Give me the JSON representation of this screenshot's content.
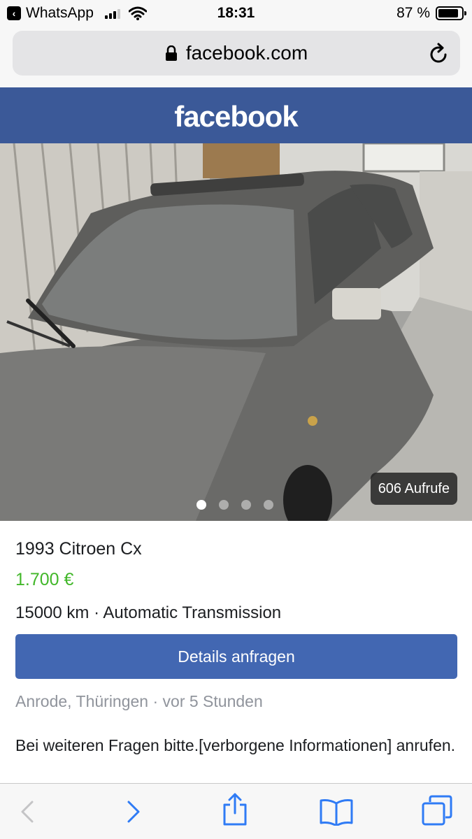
{
  "status_bar": {
    "back_app": "WhatsApp",
    "time": "18:31",
    "battery": "87 %",
    "battery_level": 0.87,
    "icons": [
      "back-arrow-icon",
      "signal-icon",
      "wifi-icon",
      "battery-icon"
    ]
  },
  "browser": {
    "url": "facebook.com",
    "icons": [
      "lock-icon",
      "reload-icon"
    ]
  },
  "header": {
    "logo": "facebook",
    "color": "#3b5998"
  },
  "photo": {
    "views": "606 Aufrufe",
    "page_count": 4,
    "active_page": 1
  },
  "listing": {
    "title": "1993 Citroen Cx",
    "price": "1.700 €",
    "specs": "15000 km · Automatic Transmission",
    "cta": "Details anfragen",
    "location": "Anrode, Thüringen · vor 5 Stunden",
    "description": "Bei weiteren Fragen bitte.[verborgene Informationen] anrufen.",
    "price_color": "#42b72a",
    "button_color": "#4267b2"
  },
  "toolbar": {
    "icons": [
      "back-icon",
      "forward-icon",
      "share-icon",
      "bookmarks-icon",
      "tabs-icon"
    ]
  }
}
